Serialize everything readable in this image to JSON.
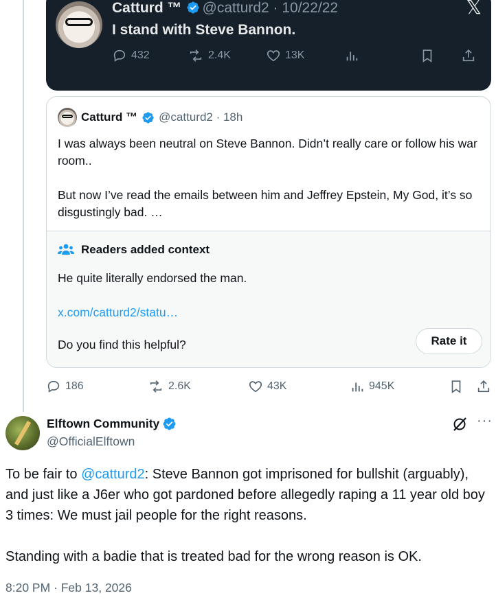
{
  "embedded_image": {
    "name": "Catturd ™",
    "handle": "@catturd2 · 10/22/22",
    "text": "I stand with Steve Bannon.",
    "x_logo": "𝕏",
    "replies": "432",
    "reposts": "2.4K",
    "likes": "13K"
  },
  "quoted_tweet": {
    "name": "Catturd ™",
    "handle": "@catturd2 · 18h",
    "text_p1": "I was always been neutral on Steve Bannon. Didn’t really care or follow his war room..",
    "text_p2": "But now I’ve read the emails between him and Jeffrey Epstein, My God, it’s so disgustingly bad. …"
  },
  "community_note": {
    "title": "Readers added context",
    "body": "He quite literally endorsed the man.",
    "link": "x.com/catturd2/statu…",
    "question": "Do you find this helpful?",
    "button": "Rate it"
  },
  "quoted_actions": {
    "replies": "186",
    "reposts": "2.6K",
    "likes": "43K",
    "views": "945K"
  },
  "reply": {
    "name": "Elftown Community",
    "handle": "@OfficialElftown",
    "text_prefix": "To be fair to ",
    "mention": "@catturd2",
    "text_rest": ": Steve Bannon got imprisoned for bullshit (arguably), and just like a J6er who got pardoned before allegedly raping a 11 year old boy 3 times: We must jail people for the right reasons.",
    "text_p2": "Standing with a badie that is treated bad for the wrong reason is OK.",
    "timestamp": "8:20 PM · Feb 13, 2026",
    "more": "···"
  },
  "colors": {
    "accent": "#1d9bf0",
    "dark_card": "#15202b",
    "secondary_text": "#536471",
    "border": "#cfd9de"
  }
}
